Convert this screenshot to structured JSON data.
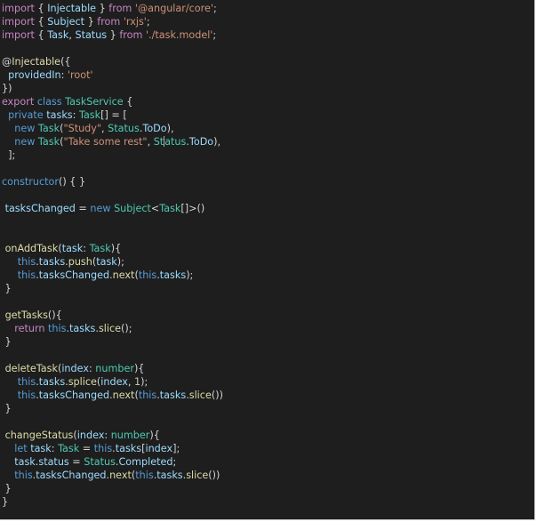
{
  "editor": {
    "lines": [
      [
        {
          "t": "import",
          "k": "kw"
        },
        {
          "t": " { ",
          "k": "pun"
        },
        {
          "t": "Injectable",
          "k": "id"
        },
        {
          "t": " } ",
          "k": "pun"
        },
        {
          "t": "from",
          "k": "kw"
        },
        {
          "t": " ",
          "k": "pun"
        },
        {
          "t": "'@angular/core'",
          "k": "str"
        },
        {
          "t": ";",
          "k": "pun"
        }
      ],
      [
        {
          "t": "import",
          "k": "kw"
        },
        {
          "t": " { ",
          "k": "pun"
        },
        {
          "t": "Subject",
          "k": "id"
        },
        {
          "t": " } ",
          "k": "pun"
        },
        {
          "t": "from",
          "k": "kw"
        },
        {
          "t": " ",
          "k": "pun"
        },
        {
          "t": "'rxjs'",
          "k": "str"
        },
        {
          "t": ";",
          "k": "pun"
        }
      ],
      [
        {
          "t": "import",
          "k": "kw"
        },
        {
          "t": " { ",
          "k": "pun"
        },
        {
          "t": "Task",
          "k": "id"
        },
        {
          "t": ", ",
          "k": "pun"
        },
        {
          "t": "Status",
          "k": "id"
        },
        {
          "t": " } ",
          "k": "pun"
        },
        {
          "t": "from",
          "k": "kw"
        },
        {
          "t": " ",
          "k": "pun"
        },
        {
          "t": "'./task.model'",
          "k": "str"
        },
        {
          "t": ";",
          "k": "pun"
        }
      ],
      [],
      [
        {
          "t": "@",
          "k": "pun"
        },
        {
          "t": "Injectable",
          "k": "dec"
        },
        {
          "t": "({",
          "k": "pun"
        }
      ],
      [
        {
          "t": "  ",
          "k": "pun"
        },
        {
          "t": "providedIn",
          "k": "id"
        },
        {
          "t": ": ",
          "k": "pun"
        },
        {
          "t": "'root'",
          "k": "str"
        }
      ],
      [
        {
          "t": "})",
          "k": "pun"
        }
      ],
      [
        {
          "t": "export",
          "k": "kw"
        },
        {
          "t": " ",
          "k": "pun"
        },
        {
          "t": "class",
          "k": "kw2"
        },
        {
          "t": " ",
          "k": "pun"
        },
        {
          "t": "TaskService",
          "k": "type"
        },
        {
          "t": " {",
          "k": "pun"
        }
      ],
      [
        {
          "t": "  ",
          "k": "pun"
        },
        {
          "t": "private",
          "k": "kw2"
        },
        {
          "t": " ",
          "k": "pun"
        },
        {
          "t": "tasks",
          "k": "id"
        },
        {
          "t": ": ",
          "k": "pun"
        },
        {
          "t": "Task",
          "k": "type"
        },
        {
          "t": "[] = [",
          "k": "pun"
        }
      ],
      [
        {
          "t": "    ",
          "k": "pun"
        },
        {
          "t": "new",
          "k": "kw2"
        },
        {
          "t": " ",
          "k": "pun"
        },
        {
          "t": "Task",
          "k": "type"
        },
        {
          "t": "(",
          "k": "pun"
        },
        {
          "t": "\"Study\"",
          "k": "str"
        },
        {
          "t": ", ",
          "k": "pun"
        },
        {
          "t": "Status",
          "k": "type"
        },
        {
          "t": ".",
          "k": "pun"
        },
        {
          "t": "ToDo",
          "k": "id"
        },
        {
          "t": "),",
          "k": "pun"
        }
      ],
      [
        {
          "t": "    ",
          "k": "pun"
        },
        {
          "t": "new",
          "k": "kw2"
        },
        {
          "t": " ",
          "k": "pun"
        },
        {
          "t": "Task",
          "k": "type"
        },
        {
          "t": "(",
          "k": "pun"
        },
        {
          "t": "\"Take some rest\"",
          "k": "str"
        },
        {
          "t": ", ",
          "k": "pun"
        },
        {
          "t": "St",
          "k": "type"
        },
        {
          "t": "CARET",
          "k": "caret"
        },
        {
          "t": "atus",
          "k": "type"
        },
        {
          "t": ".",
          "k": "pun"
        },
        {
          "t": "ToDo",
          "k": "id"
        },
        {
          "t": "),",
          "k": "pun"
        }
      ],
      [
        {
          "t": "  ];",
          "k": "pun"
        }
      ],
      [],
      [
        {
          "t": "constructor",
          "k": "kw2"
        },
        {
          "t": "() { }",
          "k": "pun"
        }
      ],
      [],
      [
        {
          "t": " ",
          "k": "pun"
        },
        {
          "t": "tasksChanged",
          "k": "id"
        },
        {
          "t": " = ",
          "k": "pun"
        },
        {
          "t": "new",
          "k": "kw2"
        },
        {
          "t": " ",
          "k": "pun"
        },
        {
          "t": "Subject",
          "k": "type"
        },
        {
          "t": "<",
          "k": "pun"
        },
        {
          "t": "Task",
          "k": "type"
        },
        {
          "t": "[]>()",
          "k": "pun"
        }
      ],
      [],
      [],
      [
        {
          "t": " ",
          "k": "pun"
        },
        {
          "t": "onAddTask",
          "k": "fn"
        },
        {
          "t": "(",
          "k": "pun"
        },
        {
          "t": "task",
          "k": "id"
        },
        {
          "t": ": ",
          "k": "pun"
        },
        {
          "t": "Task",
          "k": "type"
        },
        {
          "t": "){",
          "k": "pun"
        }
      ],
      [
        {
          "t": "     ",
          "k": "pun"
        },
        {
          "t": "this",
          "k": "kw2"
        },
        {
          "t": ".",
          "k": "pun"
        },
        {
          "t": "tasks",
          "k": "id"
        },
        {
          "t": ".",
          "k": "pun"
        },
        {
          "t": "push",
          "k": "fn"
        },
        {
          "t": "(",
          "k": "pun"
        },
        {
          "t": "task",
          "k": "id"
        },
        {
          "t": ");",
          "k": "pun"
        }
      ],
      [
        {
          "t": "     ",
          "k": "pun"
        },
        {
          "t": "this",
          "k": "kw2"
        },
        {
          "t": ".",
          "k": "pun"
        },
        {
          "t": "tasksChanged",
          "k": "id"
        },
        {
          "t": ".",
          "k": "pun"
        },
        {
          "t": "next",
          "k": "fn"
        },
        {
          "t": "(",
          "k": "pun"
        },
        {
          "t": "this",
          "k": "kw2"
        },
        {
          "t": ".",
          "k": "pun"
        },
        {
          "t": "tasks",
          "k": "id"
        },
        {
          "t": ");",
          "k": "pun"
        }
      ],
      [
        {
          "t": " }",
          "k": "pun"
        }
      ],
      [],
      [
        {
          "t": " ",
          "k": "pun"
        },
        {
          "t": "getTasks",
          "k": "fn"
        },
        {
          "t": "(){",
          "k": "pun"
        }
      ],
      [
        {
          "t": "    ",
          "k": "pun"
        },
        {
          "t": "return",
          "k": "kw"
        },
        {
          "t": " ",
          "k": "pun"
        },
        {
          "t": "this",
          "k": "kw2"
        },
        {
          "t": ".",
          "k": "pun"
        },
        {
          "t": "tasks",
          "k": "id"
        },
        {
          "t": ".",
          "k": "pun"
        },
        {
          "t": "slice",
          "k": "fn"
        },
        {
          "t": "();",
          "k": "pun"
        }
      ],
      [
        {
          "t": " }",
          "k": "pun"
        }
      ],
      [],
      [
        {
          "t": " ",
          "k": "pun"
        },
        {
          "t": "deleteTask",
          "k": "fn"
        },
        {
          "t": "(",
          "k": "pun"
        },
        {
          "t": "index",
          "k": "id"
        },
        {
          "t": ": ",
          "k": "pun"
        },
        {
          "t": "number",
          "k": "type"
        },
        {
          "t": "){",
          "k": "pun"
        }
      ],
      [
        {
          "t": "     ",
          "k": "pun"
        },
        {
          "t": "this",
          "k": "kw2"
        },
        {
          "t": ".",
          "k": "pun"
        },
        {
          "t": "tasks",
          "k": "id"
        },
        {
          "t": ".",
          "k": "pun"
        },
        {
          "t": "splice",
          "k": "fn"
        },
        {
          "t": "(",
          "k": "pun"
        },
        {
          "t": "index",
          "k": "id"
        },
        {
          "t": ", ",
          "k": "pun"
        },
        {
          "t": "1",
          "k": "num"
        },
        {
          "t": ");",
          "k": "pun"
        }
      ],
      [
        {
          "t": "     ",
          "k": "pun"
        },
        {
          "t": "this",
          "k": "kw2"
        },
        {
          "t": ".",
          "k": "pun"
        },
        {
          "t": "tasksChanged",
          "k": "id"
        },
        {
          "t": ".",
          "k": "pun"
        },
        {
          "t": "next",
          "k": "fn"
        },
        {
          "t": "(",
          "k": "pun"
        },
        {
          "t": "this",
          "k": "kw2"
        },
        {
          "t": ".",
          "k": "pun"
        },
        {
          "t": "tasks",
          "k": "id"
        },
        {
          "t": ".",
          "k": "pun"
        },
        {
          "t": "slice",
          "k": "fn"
        },
        {
          "t": "())",
          "k": "pun"
        }
      ],
      [
        {
          "t": " }",
          "k": "pun"
        }
      ],
      [],
      [
        {
          "t": " ",
          "k": "pun"
        },
        {
          "t": "changeStatus",
          "k": "fn"
        },
        {
          "t": "(",
          "k": "pun"
        },
        {
          "t": "index",
          "k": "id"
        },
        {
          "t": ": ",
          "k": "pun"
        },
        {
          "t": "number",
          "k": "type"
        },
        {
          "t": "){",
          "k": "pun"
        }
      ],
      [
        {
          "t": "    ",
          "k": "pun"
        },
        {
          "t": "let",
          "k": "kw2"
        },
        {
          "t": " ",
          "k": "pun"
        },
        {
          "t": "task",
          "k": "id"
        },
        {
          "t": ": ",
          "k": "pun"
        },
        {
          "t": "Task",
          "k": "type"
        },
        {
          "t": " = ",
          "k": "pun"
        },
        {
          "t": "this",
          "k": "kw2"
        },
        {
          "t": ".",
          "k": "pun"
        },
        {
          "t": "tasks",
          "k": "id"
        },
        {
          "t": "[",
          "k": "pun"
        },
        {
          "t": "index",
          "k": "id"
        },
        {
          "t": "];",
          "k": "pun"
        }
      ],
      [
        {
          "t": "    ",
          "k": "pun"
        },
        {
          "t": "task",
          "k": "id"
        },
        {
          "t": ".",
          "k": "pun"
        },
        {
          "t": "status",
          "k": "id"
        },
        {
          "t": " = ",
          "k": "pun"
        },
        {
          "t": "Status",
          "k": "type"
        },
        {
          "t": ".",
          "k": "pun"
        },
        {
          "t": "Completed",
          "k": "id"
        },
        {
          "t": ";",
          "k": "pun"
        }
      ],
      [
        {
          "t": "    ",
          "k": "pun"
        },
        {
          "t": "this",
          "k": "kw2"
        },
        {
          "t": ".",
          "k": "pun"
        },
        {
          "t": "tasksChanged",
          "k": "id"
        },
        {
          "t": ".",
          "k": "pun"
        },
        {
          "t": "next",
          "k": "fn"
        },
        {
          "t": "(",
          "k": "pun"
        },
        {
          "t": "this",
          "k": "kw2"
        },
        {
          "t": ".",
          "k": "pun"
        },
        {
          "t": "tasks",
          "k": "id"
        },
        {
          "t": ".",
          "k": "pun"
        },
        {
          "t": "slice",
          "k": "fn"
        },
        {
          "t": "())",
          "k": "pun"
        }
      ],
      [
        {
          "t": " }",
          "k": "pun"
        }
      ],
      [
        {
          "t": "}",
          "k": "pun"
        }
      ]
    ]
  },
  "colors": {
    "background": "#1e1e1e",
    "keyword_control": "#c586c0",
    "keyword": "#569cd6",
    "identifier": "#9cdcfe",
    "type": "#4ec9b0",
    "function": "#dcdcaa",
    "string": "#ce9178",
    "number": "#b5cea8",
    "punctuation": "#d4d4d4"
  }
}
